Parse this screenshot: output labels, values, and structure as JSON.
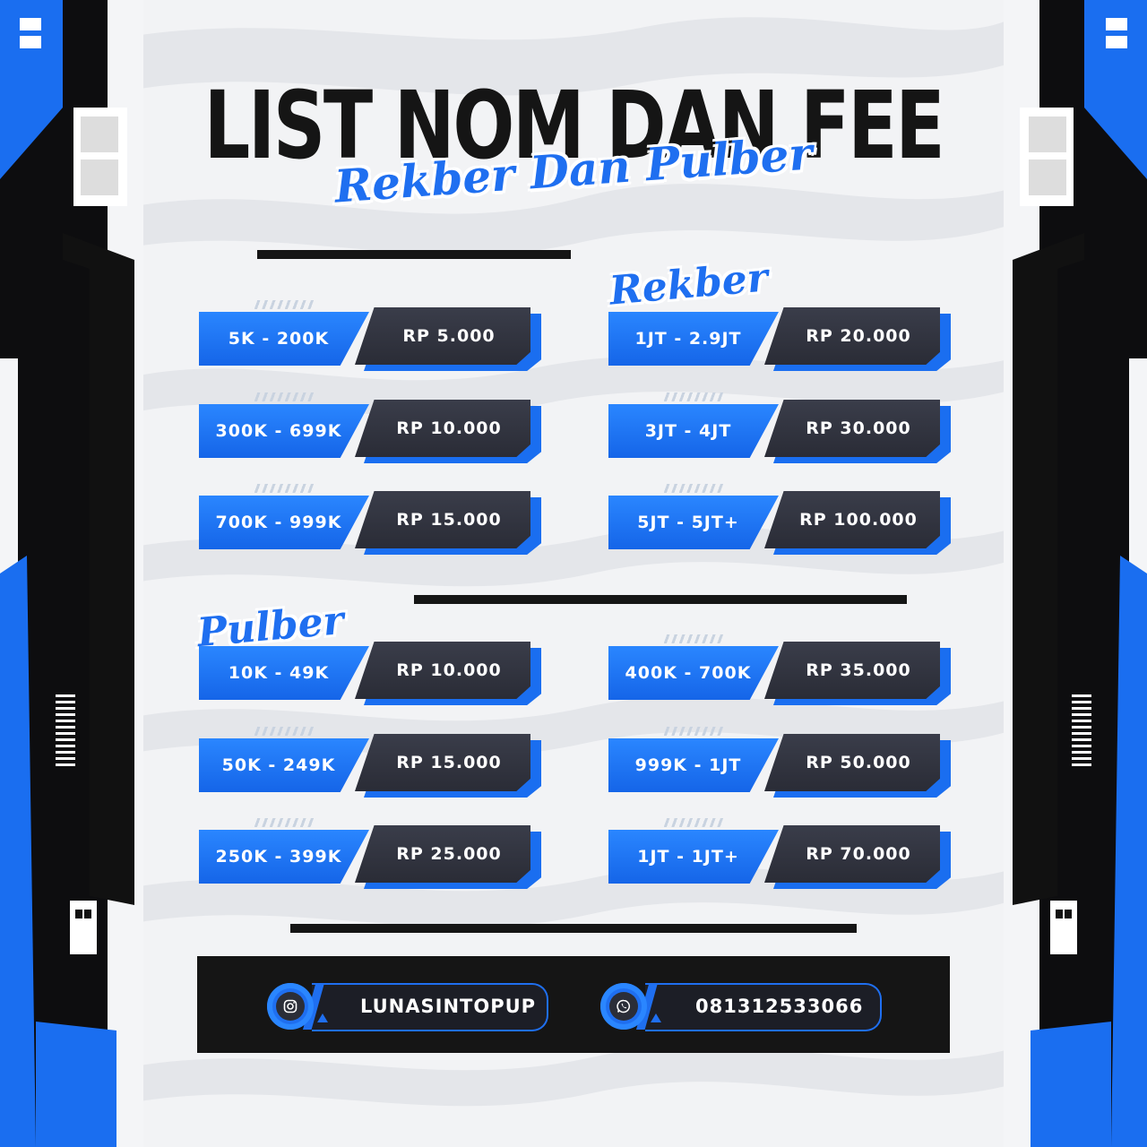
{
  "title": "LIST NOM DAN FEE",
  "subtitle": "Rekber Dan Pulber",
  "rekber": {
    "label": "Rekber",
    "left": [
      {
        "range": "5K - 200K",
        "fee": "RP 5.000"
      },
      {
        "range": "300K - 699K",
        "fee": "RP 10.000"
      },
      {
        "range": "700K - 999K",
        "fee": "RP 15.000"
      }
    ],
    "right": [
      {
        "range": "1JT - 2.9JT",
        "fee": "RP 20.000"
      },
      {
        "range": "3JT - 4JT",
        "fee": "RP 30.000"
      },
      {
        "range": "5JT - 5JT+",
        "fee": "RP 100.000"
      }
    ]
  },
  "pulber": {
    "label": "Pulber",
    "left": [
      {
        "range": "10K - 49K",
        "fee": "RP 10.000"
      },
      {
        "range": "50K - 249K",
        "fee": "RP 15.000"
      },
      {
        "range": "250K - 399K",
        "fee": "RP 25.000"
      }
    ],
    "right": [
      {
        "range": "400K - 700K",
        "fee": "RP 35.000"
      },
      {
        "range": "999K - 1JT",
        "fee": "RP 50.000"
      },
      {
        "range": "1JT - 1JT+",
        "fee": "RP 70.000"
      }
    ]
  },
  "contacts": {
    "instagram": {
      "icon": "instagram-icon",
      "handle": "LUNASINTOPUP"
    },
    "whatsapp": {
      "icon": "whatsapp-icon",
      "number": "081312533066"
    }
  },
  "colors": {
    "accent": "#1f6ff0",
    "dark": "#151515",
    "fee_box": "#2b2e38"
  }
}
